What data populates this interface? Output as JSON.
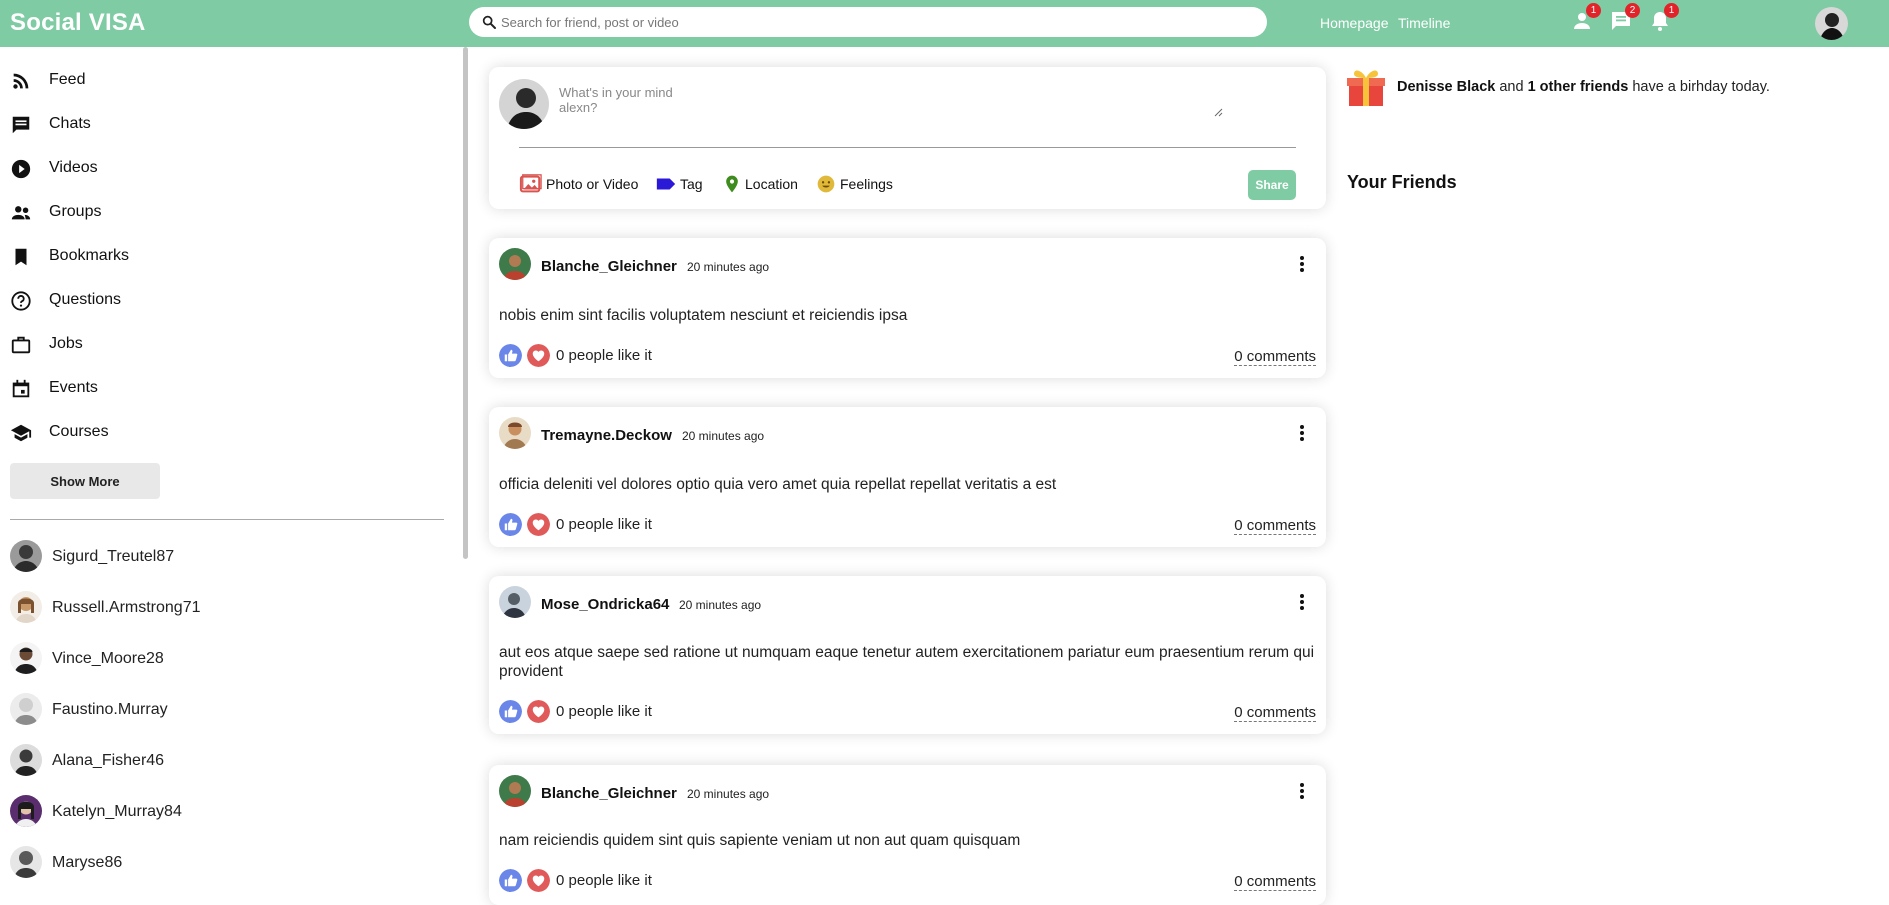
{
  "app": {
    "logo": "Social VISA",
    "brand_color": "#7fcba4"
  },
  "search": {
    "placeholder": "Search for friend, post or video"
  },
  "topbar": {
    "links": [
      "Homepage",
      "Timeline"
    ],
    "badges": {
      "friends": "1",
      "messages": "2",
      "notifications": "1"
    }
  },
  "sidebar": {
    "items": [
      {
        "label": "Feed",
        "icon": "rss-feed-icon"
      },
      {
        "label": "Chats",
        "icon": "chat-icon"
      },
      {
        "label": "Videos",
        "icon": "play-circle-icon"
      },
      {
        "label": "Groups",
        "icon": "group-icon"
      },
      {
        "label": "Bookmarks",
        "icon": "bookmark-icon"
      },
      {
        "label": "Questions",
        "icon": "help-circle-icon"
      },
      {
        "label": "Jobs",
        "icon": "briefcase-icon"
      },
      {
        "label": "Events",
        "icon": "calendar-icon"
      },
      {
        "label": "Courses",
        "icon": "school-icon"
      }
    ],
    "show_more": "Show More",
    "friends": [
      "Sigurd_Treutel87",
      "Russell.Armstrong71",
      "Vince_Moore28",
      "Faustino.Murray",
      "Alana_Fisher46",
      "Katelyn_Murray84",
      "Maryse86"
    ]
  },
  "share": {
    "placeholder": "What's in your mind alexn?",
    "options": [
      "Photo or Video",
      "Tag",
      "Location",
      "Feelings"
    ],
    "button": "Share"
  },
  "posts": [
    {
      "user": "Blanche_Gleichner",
      "time": "20 minutes ago",
      "text": "nobis enim sint facilis voluptatem nesciunt et reiciendis ipsa",
      "likes": "0 people like it",
      "comments": "0 comments"
    },
    {
      "user": "Tremayne.Deckow",
      "time": "20 minutes ago",
      "text": "officia deleniti vel dolores optio quia vero amet quia repellat repellat veritatis a est",
      "likes": "0 people like it",
      "comments": "0 comments"
    },
    {
      "user": "Mose_Ondricka64",
      "time": "20 minutes ago",
      "text": "aut eos atque saepe sed ratione ut numquam eaque tenetur autem exercitationem pariatur eum praesentium rerum qui provident",
      "likes": "0 people like it",
      "comments": "0 comments"
    },
    {
      "user": "Blanche_Gleichner",
      "time": "20 minutes ago",
      "text": "nam reiciendis quidem sint quis sapiente veniam ut non aut quam quisquam",
      "likes": "0 people like it",
      "comments": "0 comments"
    }
  ],
  "birthday": {
    "name": "Denisse Black",
    "and": " and ",
    "others": "1 other friends",
    "suffix": " have a birhday today."
  },
  "right": {
    "friends_title": "Your Friends"
  }
}
